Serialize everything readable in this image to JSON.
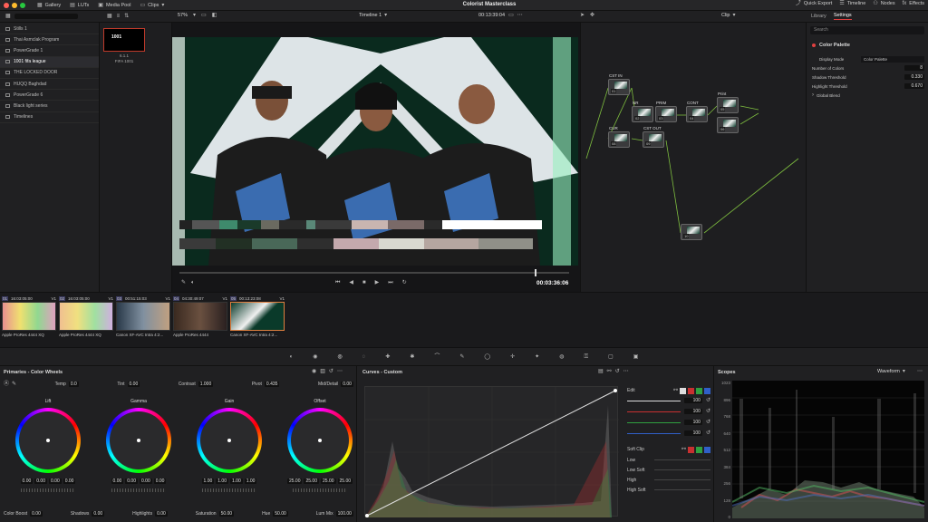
{
  "topbar": {
    "gallery": "Gallery",
    "luts": "LUTs",
    "media_pool": "Media Pool",
    "clips": "Clips",
    "project_title": "Colorist Masterclass",
    "quick_export": "Quick Export",
    "timeline": "Timeline",
    "nodes": "Nodes",
    "effects": "Effects"
  },
  "toolbar2": {
    "zoom": "57%",
    "timeline_name": "Timeline 1",
    "timecode": "00:13:39:04",
    "clip_mode": "Clip",
    "library": "Library",
    "settings": "Settings"
  },
  "gallery": {
    "items": [
      {
        "label": "Stills 1",
        "active": false
      },
      {
        "label": "Thai Asmclak Program",
        "active": false
      },
      {
        "label": "PowerGrade 1",
        "active": false
      },
      {
        "label": "1001 fifa league",
        "active": true
      },
      {
        "label": "THE LOCKED DOOR",
        "active": false
      },
      {
        "label": "HUQQ Baghdad",
        "active": false
      },
      {
        "label": "PowerGrade 6",
        "active": false
      },
      {
        "label": "Black light series",
        "active": false
      },
      {
        "label": "Timelines",
        "active": false
      }
    ],
    "still_num": "6.1.1",
    "still_label": "FIFA 1001",
    "still_logo": "1001"
  },
  "viewer": {
    "timecode": "00:03:36:06"
  },
  "timeline_clips": [
    {
      "num": "01",
      "tc": "16:03:05:00",
      "track": "V1",
      "codec": "Apple ProRes 4444 XQ"
    },
    {
      "num": "02",
      "tc": "16:03:05:00",
      "track": "V1",
      "codec": "Apple ProRes 4444 XQ"
    },
    {
      "num": "03",
      "tc": "00:51:15:03",
      "track": "V1",
      "codec": "Canon XF-AVC Intra 4:2..."
    },
    {
      "num": "04",
      "tc": "04:30:49:07",
      "track": "V1",
      "codec": "Apple ProRes 4444"
    },
    {
      "num": "05",
      "tc": "00:13:23:08",
      "track": "V1",
      "codec": "Canon XF-AVC Intra 4:2..."
    }
  ],
  "nodes": [
    {
      "label": "CST IN",
      "num": "01"
    },
    {
      "label": "NR",
      "num": "02"
    },
    {
      "label": "PRIM",
      "num": "03"
    },
    {
      "label": "CONT",
      "num": "04"
    },
    {
      "label": "Print",
      "num": "05"
    },
    {
      "label": "",
      "num": "06"
    },
    {
      "label": "CUR",
      "num": "08"
    },
    {
      "label": "CST OUT",
      "num": "09"
    },
    {
      "label": "",
      "num": "10"
    }
  ],
  "settings_panel": {
    "search": "Search",
    "title": "Color Palette",
    "display_mode_label": "Display Mode",
    "display_mode_value": "Color Palette",
    "num_colors_label": "Number of Colors",
    "num_colors_value": "8",
    "shadow_label": "Shadow Threshold",
    "shadow_value": "0.330",
    "highlight_label": "Highlight Threshold",
    "highlight_value": "0.670",
    "global_blend": "Global Blend"
  },
  "primaries": {
    "title": "Primaries - Color Wheels",
    "temp_label": "Temp",
    "temp": "0.0",
    "tint_label": "Tint",
    "tint": "0.00",
    "contrast_label": "Contrast",
    "contrast": "1.000",
    "pivot_label": "Pivot",
    "pivot": "0.435",
    "middetail_label": "Mid/Detail",
    "middetail": "0.00",
    "wheels": [
      {
        "name": "Lift",
        "values": [
          "0.00",
          "0.00",
          "0.00",
          "0.00"
        ]
      },
      {
        "name": "Gamma",
        "values": [
          "0.00",
          "0.00",
          "0.00",
          "0.00"
        ]
      },
      {
        "name": "Gain",
        "values": [
          "1.00",
          "1.00",
          "1.00",
          "1.00"
        ]
      },
      {
        "name": "Offset",
        "values": [
          "25.00",
          "25.00",
          "25.00",
          "25.00"
        ]
      }
    ],
    "color_boost_label": "Color Boost",
    "color_boost": "0.00",
    "shadows_label": "Shadows",
    "shadows": "0.00",
    "highlights_label": "Highlights",
    "highlights": "0.00",
    "saturation_label": "Saturation",
    "saturation": "50.00",
    "hue_label": "Hue",
    "hue": "50.00",
    "lummix_label": "Lum Mix",
    "lummix": "100.00"
  },
  "curves": {
    "title": "Curves - Custom",
    "edit_label": "Edit",
    "intensities": [
      "100",
      "100",
      "100",
      "100"
    ],
    "soft_clip": "Soft Clip",
    "low": "Low",
    "low_soft": "Low Soft",
    "high": "High",
    "high_soft": "High Soft"
  },
  "scopes": {
    "title": "Scopes",
    "mode": "Waveform",
    "ticks": [
      "1023",
      "896",
      "768",
      "640",
      "512",
      "384",
      "256",
      "128",
      "0"
    ]
  }
}
